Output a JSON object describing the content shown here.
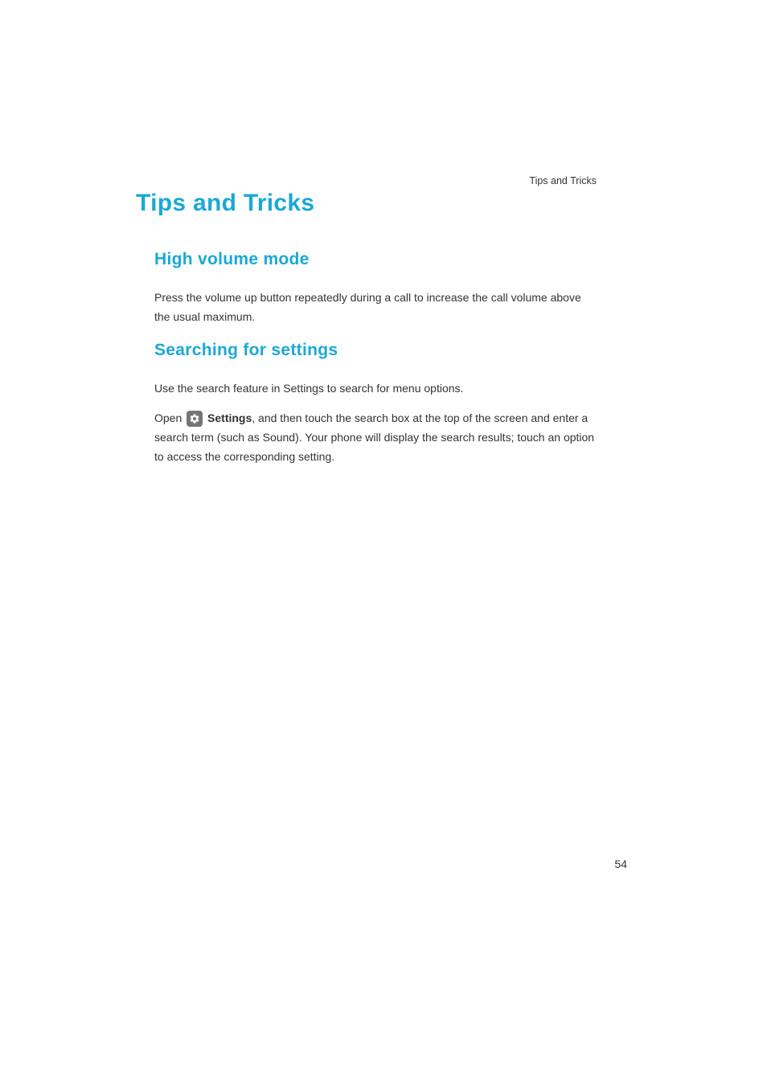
{
  "header": {
    "breadcrumb": "Tips and Tricks"
  },
  "page": {
    "title": "Tips and Tricks",
    "number": "54"
  },
  "sections": {
    "high_volume": {
      "title": "High volume mode",
      "body": "Press the volume up button repeatedly during a call to increase the call volume above the usual maximum."
    },
    "searching_settings": {
      "title": "Searching for settings",
      "body1": "Use the search feature in Settings to search for menu options.",
      "body2_open": "Open ",
      "body2_settings": "Settings",
      "body2_rest": ", and then touch the search box at the top of the screen and enter a search term (such as Sound). Your phone will display the search results; touch an option to access the corresponding setting."
    }
  }
}
